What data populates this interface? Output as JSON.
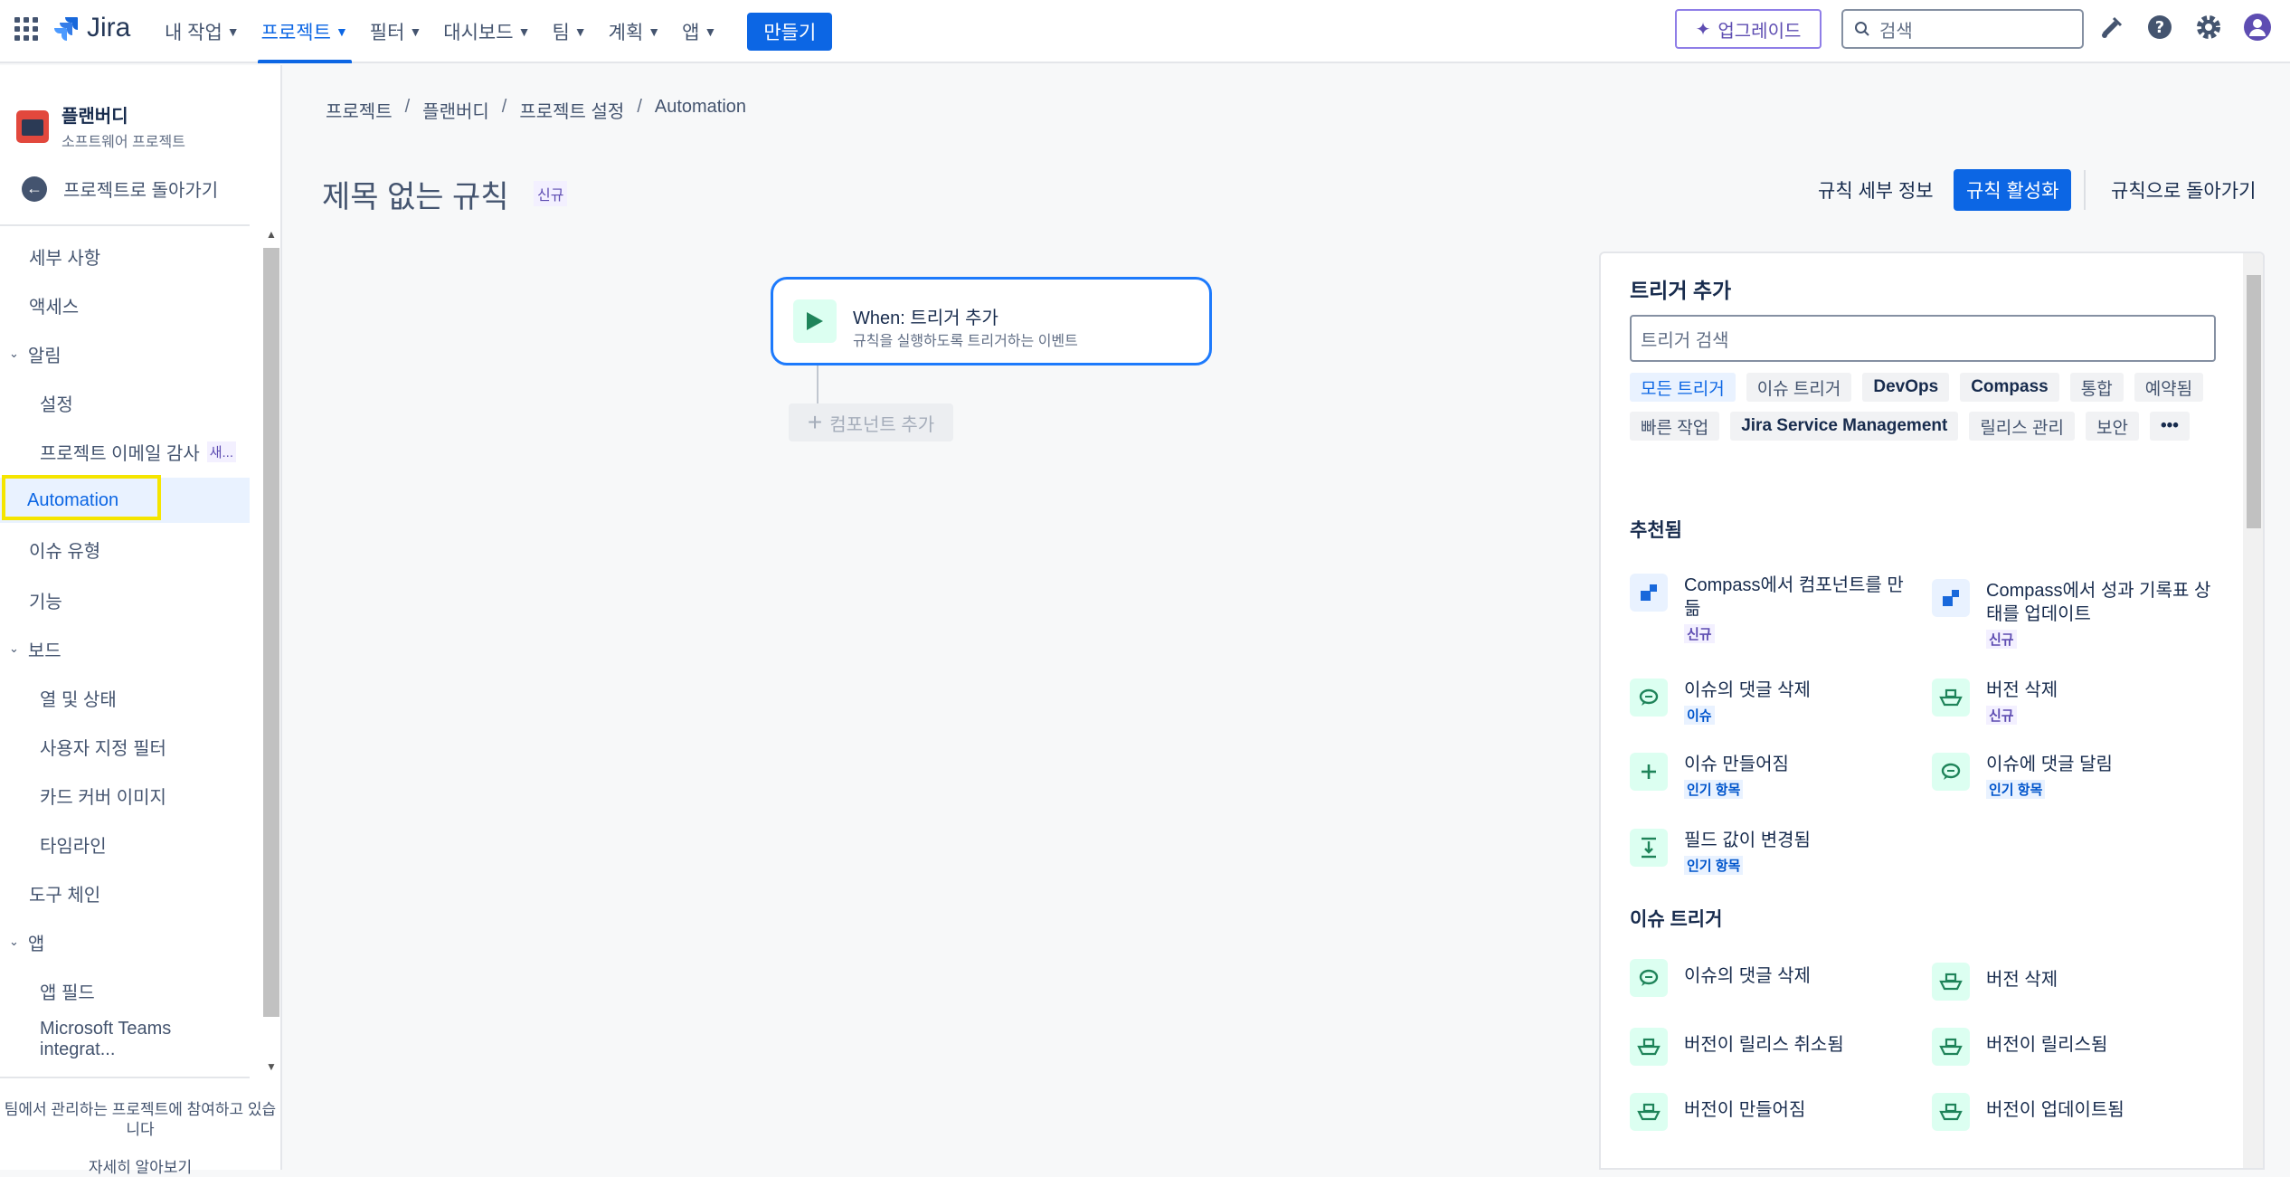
{
  "app": {
    "name": "Jira"
  },
  "topnav": [
    {
      "label": "내 작업",
      "active": false
    },
    {
      "label": "프로젝트",
      "active": true
    },
    {
      "label": "필터",
      "active": false
    },
    {
      "label": "대시보드",
      "active": false
    },
    {
      "label": "팀",
      "active": false
    },
    {
      "label": "계획",
      "active": false
    },
    {
      "label": "앱",
      "active": false
    }
  ],
  "create_label": "만들기",
  "upgrade_label": "업그레이드",
  "search_placeholder": "검색",
  "project": {
    "name": "플랜버디",
    "type": "소프트웨어 프로젝트"
  },
  "back_label": "프로젝트로 돌아가기",
  "sidebar": {
    "details": "세부 사항",
    "access": "액세스",
    "notifications": "알림",
    "settings": "설정",
    "email_audit": "프로젝트 이메일 감사",
    "email_audit_badge": "새...",
    "automation": "Automation",
    "issue_types": "이슈 유형",
    "features": "기능",
    "board": "보드",
    "columns": "열 및 상태",
    "custom_filters": "사용자 지정 필터",
    "card_covers": "카드 커버 이미지",
    "timeline": "타임라인",
    "toolchain": "도구 체인",
    "apps": "앱",
    "app_fields": "앱 필드",
    "teams": "Microsoft Teams integrat...",
    "footer": "팀에서 관리하는 프로젝트에 참여하고 있습니다",
    "footer_link": "자세히 알아보기"
  },
  "breadcrumb": [
    "프로젝트",
    "플랜버디",
    "프로젝트 설정",
    "Automation"
  ],
  "rule": {
    "title": "제목 없는 규칙",
    "badge": "신규",
    "details_btn": "규칙 세부 정보",
    "activate_btn": "규칙 활성화",
    "back_btn": "규칙으로 돌아가기"
  },
  "trigger_card": {
    "title": "When: 트리거 추가",
    "subtitle": "규칙을 실행하도록 트리거하는 이벤트",
    "add_component": "컴포넌트 추가"
  },
  "panel": {
    "title": "트리거 추가",
    "search_placeholder": "트리거 검색",
    "chips": [
      "모든 트리거",
      "이슈 트리거",
      "DevOps",
      "Compass",
      "통합",
      "예약됨",
      "빠른 작업",
      "Jira Service Management",
      "릴리스 관리",
      "보안"
    ],
    "more": "•••",
    "recommended_title": "추천됨",
    "recommended": [
      {
        "label": "Compass에서 컴포넌트를 만듦",
        "badge": "신규"
      },
      {
        "label": "Compass에서 성과 기록표 상태를 업데이트",
        "badge": "신규"
      },
      {
        "label": "이슈의 댓글 삭제",
        "badge": "이슈"
      },
      {
        "label": "버전 삭제",
        "badge": "신규"
      },
      {
        "label": "이슈 만들어짐",
        "badge": "인기 항목"
      },
      {
        "label": "이슈에 댓글 달림",
        "badge": "인기 항목"
      },
      {
        "label": "필드 값이 변경됨",
        "badge": "인기 항목"
      }
    ],
    "issue_triggers_title": "이슈 트리거",
    "issue_triggers": [
      "이슈의 댓글 삭제",
      "버전 삭제",
      "버전이 릴리스 취소됨",
      "버전이 릴리스됨",
      "버전이 만들어짐",
      "버전이 업데이트됨"
    ]
  }
}
